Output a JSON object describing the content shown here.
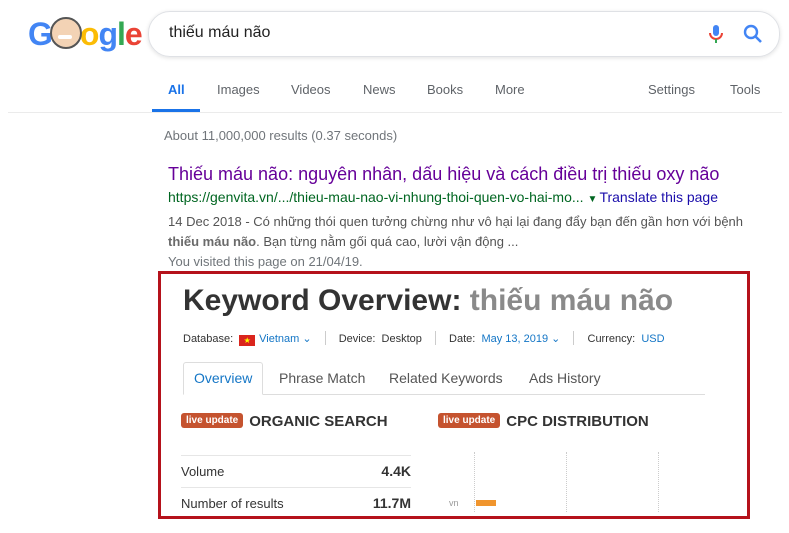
{
  "google": {
    "search_query": "thiếu máu não"
  },
  "tabs": {
    "all": "All",
    "images": "Images",
    "videos": "Videos",
    "news": "News",
    "books": "Books",
    "more": "More",
    "settings": "Settings",
    "tools": "Tools"
  },
  "results_stats": "About 11,000,000 results (0.37 seconds)",
  "result": {
    "title": "Thiếu máu não: nguyên nhân, dấu hiệu và cách điều trị thiếu oxy não",
    "url": "https://genvita.vn/.../thieu-mau-nao-vi-nhung-thoi-quen-vo-hai-mo...",
    "translate": "Translate this page",
    "date": "14 Dec 2018",
    "snippet_a": " - Có những thói quen tưởng chừng như vô hại lại đang đẩy bạn đến gần hơn với bệnh ",
    "snippet_bold": "thiếu máu não",
    "snippet_b": ". Bạn từng nằm gối quá cao, lười vận động ...",
    "visited": "You visited this page on 21/04/19."
  },
  "keyword_overview": {
    "title_prefix": "Keyword Overview:",
    "keyword": "thiếu máu não",
    "database_label": "Database:",
    "database_value": "Vietnam",
    "device_label": "Device:",
    "device_value": "Desktop",
    "date_label": "Date:",
    "date_value": "May 13, 2019",
    "currency_label": "Currency:",
    "currency_value": "USD",
    "tabs": [
      "Overview",
      "Phrase Match",
      "Related Keywords",
      "Ads History"
    ],
    "live_badge": "live update",
    "organic_heading": "ORGANIC SEARCH",
    "cpc_heading": "CPC DISTRIBUTION",
    "organic_rows": [
      {
        "label": "Volume",
        "value": "4.4K"
      },
      {
        "label": "Number of results",
        "value": "11.7M"
      }
    ],
    "cpc_country": "vn"
  },
  "colors": {
    "highlight_border": "#b5121b",
    "link": "#1a0dab",
    "visited_link": "#660099",
    "url_green": "#006621",
    "badge": "#c5532f"
  }
}
